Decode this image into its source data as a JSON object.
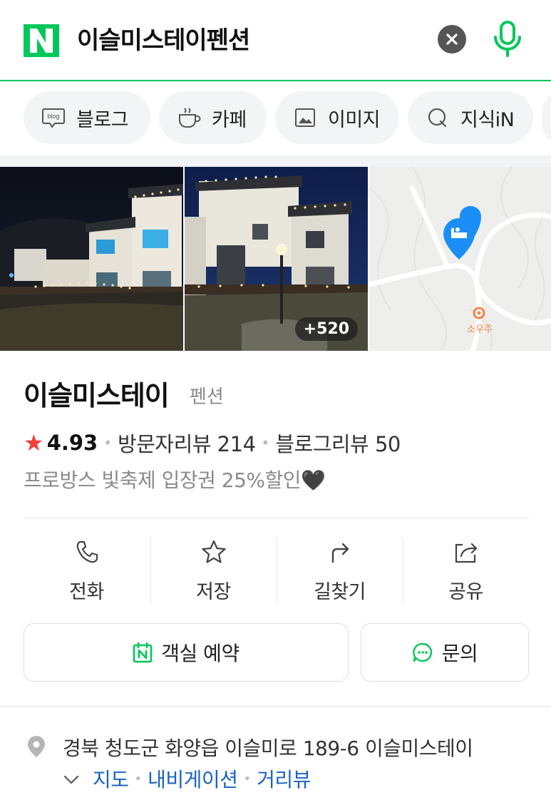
{
  "search": {
    "query": "이슬미스테이펜션"
  },
  "tabs": [
    {
      "label": "블로그",
      "icon": "blog-icon"
    },
    {
      "label": "카페",
      "icon": "cafe-icon"
    },
    {
      "label": "이미지",
      "icon": "image-icon"
    },
    {
      "label": "지식iN",
      "icon": "kin-icon"
    }
  ],
  "photos": {
    "more_count": "+520",
    "map_label": "소우주"
  },
  "place": {
    "name": "이슬미스테이",
    "category": "펜션",
    "rating": "4.93",
    "visitor_reviews": "방문자리뷰 214",
    "blog_reviews": "블로그리뷰 50",
    "promo": "프로방스 빛축제 입장권 25%할인🖤"
  },
  "actions": [
    {
      "label": "전화",
      "icon": "phone-icon"
    },
    {
      "label": "저장",
      "icon": "star-icon"
    },
    {
      "label": "길찾기",
      "icon": "directions-icon"
    },
    {
      "label": "공유",
      "icon": "share-icon"
    }
  ],
  "buttons": {
    "reserve": "객실 예약",
    "inquiry": "문의"
  },
  "address": {
    "text": "경북 청도군 화양읍 이슬미로 189-6 이슬미스테이",
    "links": [
      "지도",
      "내비게이션",
      "거리뷰"
    ]
  },
  "colors": {
    "brand": "#03c75a",
    "link": "#1a63c4",
    "star": "#f33c3c",
    "map_pin": "#1b8ef5"
  }
}
